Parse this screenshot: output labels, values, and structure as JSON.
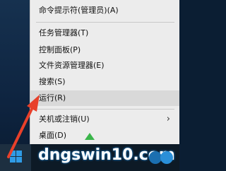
{
  "context_menu": {
    "items": [
      {
        "label": "命令提示符(管理员)(A)",
        "highlighted": false,
        "submenu": false
      },
      {
        "label": "任务管理器(T)",
        "highlighted": false,
        "submenu": false
      },
      {
        "label": "控制面板(P)",
        "highlighted": false,
        "submenu": false
      },
      {
        "label": "文件资源管理器(E)",
        "highlighted": false,
        "submenu": false
      },
      {
        "label": "搜索(S)",
        "highlighted": false,
        "submenu": false
      },
      {
        "label": "运行(R)",
        "highlighted": true,
        "submenu": false
      },
      {
        "label": "关机或注销(U)",
        "highlighted": false,
        "submenu": true
      },
      {
        "label": "桌面(D)",
        "highlighted": false,
        "submenu": false
      }
    ],
    "submenu_chevron": "›"
  },
  "taskbar": {
    "start_button_icon": "windows-logo-icon"
  },
  "annotation": {
    "arrow_color": "#e8402a"
  },
  "watermark": {
    "text": "dngswin10.com"
  },
  "colors": {
    "menu_bg": "#ececec",
    "highlight": "#d9d9d9",
    "taskbar": "#0d1a26"
  }
}
